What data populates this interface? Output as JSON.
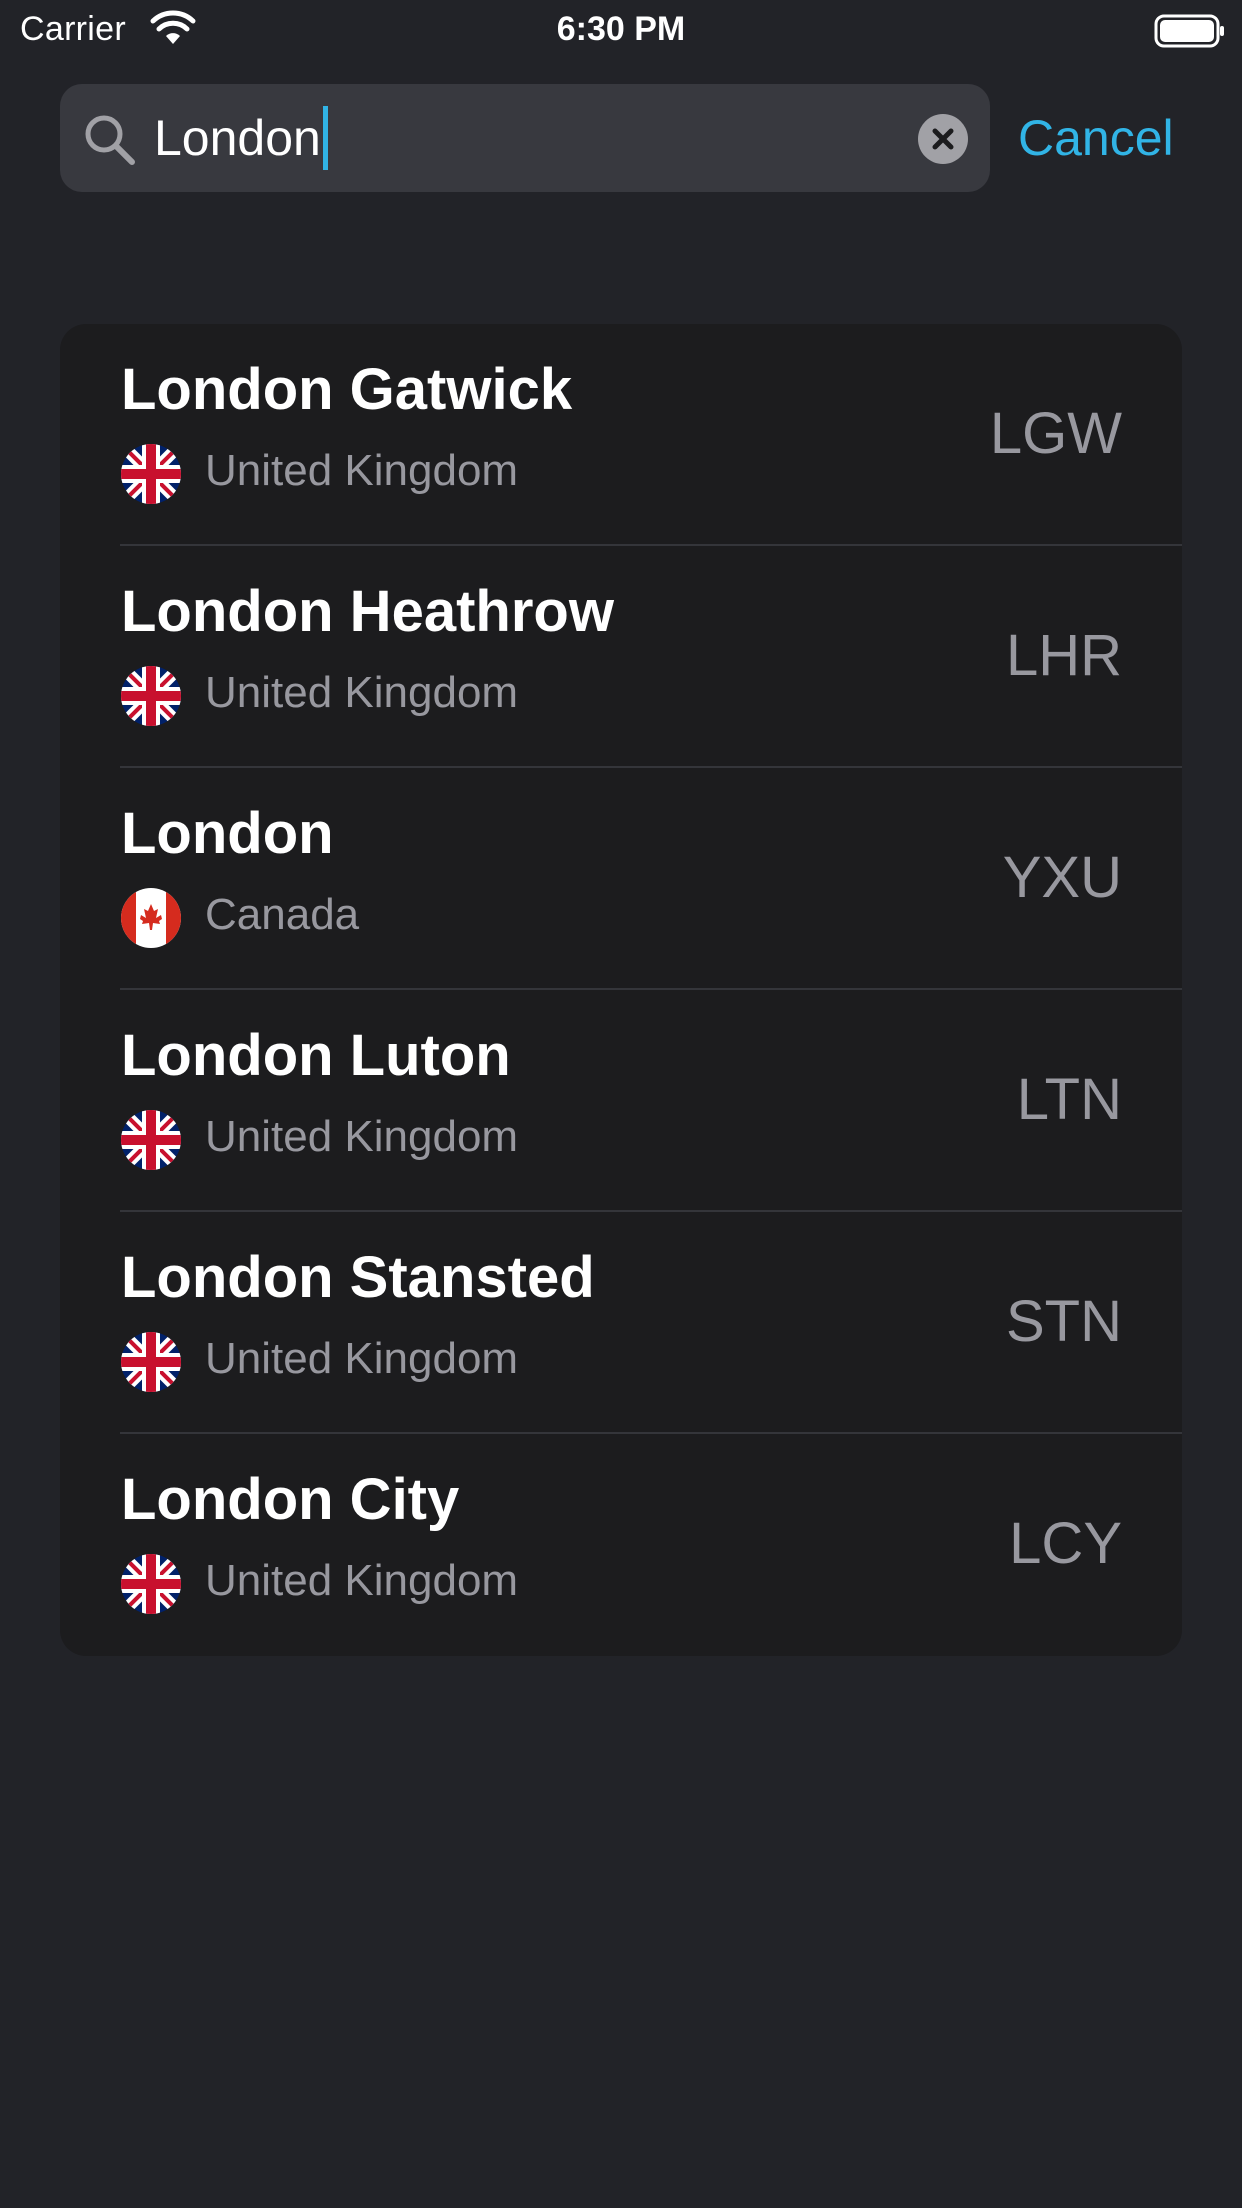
{
  "status_bar": {
    "carrier": "Carrier",
    "time": "6:30 PM",
    "wifi_icon": "wifi-icon",
    "battery_icon": "battery-icon"
  },
  "search": {
    "query": "London",
    "icon": "search-icon",
    "clear_icon": "clear-icon",
    "cancel_label": "Cancel"
  },
  "colors": {
    "accent": "#31b4e6",
    "background": "#222328",
    "card": "#1c1c1e",
    "secondary_text": "#98989f"
  },
  "results": [
    {
      "name": "London Gatwick",
      "country": "United Kingdom",
      "flag": "uk-flag-icon",
      "code": "LGW"
    },
    {
      "name": "London Heathrow",
      "country": "United Kingdom",
      "flag": "uk-flag-icon",
      "code": "LHR"
    },
    {
      "name": "London",
      "country": "Canada",
      "flag": "canada-flag-icon",
      "code": "YXU"
    },
    {
      "name": "London Luton",
      "country": "United Kingdom",
      "flag": "uk-flag-icon",
      "code": "LTN"
    },
    {
      "name": "London Stansted",
      "country": "United Kingdom",
      "flag": "uk-flag-icon",
      "code": "STN"
    },
    {
      "name": "London City",
      "country": "United Kingdom",
      "flag": "uk-flag-icon",
      "code": "LCY"
    }
  ]
}
